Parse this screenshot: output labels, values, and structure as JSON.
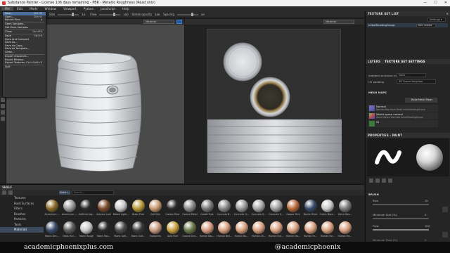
{
  "titlebar": {
    "title": "Substance Painter - License 106 days remaining - PBR - Metallic Roughness (Read only)",
    "minimize": "—",
    "maximize": "☐",
    "close": "✕"
  },
  "menubar": [
    "File",
    "Edit",
    "Mode",
    "Window",
    "Viewport",
    "Python",
    "JavaScript",
    "Help"
  ],
  "toolbar": {
    "size_label": "Size",
    "size_value": "10",
    "flow_label": "Flow",
    "flow_value": "100",
    "stroke_label": "Stroke opacity",
    "stroke_value": "100",
    "spacing_label": "Spacing",
    "spacing_value": "20"
  },
  "viewport3d": {
    "mode": "Material"
  },
  "viewport2d": {
    "mode": "Material"
  },
  "file_menu": [
    {
      "label": "New...",
      "shortcut": "Ctrl+N"
    },
    {
      "label": "Open...",
      "shortcut": "Ctrl+O"
    },
    {
      "label": "Recent Files",
      "shortcut": "▸"
    },
    {
      "sep": true
    },
    {
      "label": "Open Samples...",
      "shortcut": ""
    },
    {
      "label": "Get More Samples",
      "shortcut": ""
    },
    {
      "sep": true
    },
    {
      "label": "Close",
      "shortcut": "Ctrl+F4"
    },
    {
      "sep": true
    },
    {
      "label": "Save",
      "shortcut": "Ctrl+S"
    },
    {
      "label": "Save And Compact",
      "shortcut": ""
    },
    {
      "label": "Save As...",
      "shortcut": ""
    },
    {
      "label": "Save As Copy...",
      "shortcut": ""
    },
    {
      "label": "Save As Template...",
      "shortcut": ""
    },
    {
      "label": "Clean...",
      "shortcut": ""
    },
    {
      "sep": true
    },
    {
      "label": "Import resources...",
      "shortcut": ""
    },
    {
      "label": "Export Bitmap...",
      "shortcut": ""
    },
    {
      "label": "Export Textures...",
      "shortcut": "Ctrl+Shift+E"
    },
    {
      "sep": true
    },
    {
      "label": "Quit",
      "shortcut": ""
    }
  ],
  "texture_set_list": {
    "header": "TEXTURE SET LIST",
    "settings": "Settings ▾",
    "item": "InitialShadingGroup",
    "shader": "Main shader"
  },
  "layers_tabs": [
    "LAYERS",
    "TEXTURE SET SETTINGS"
  ],
  "texture_set_settings": {
    "ao_label": "Ambient occlusion map",
    "ao_value": "None",
    "uv_label": "UV padding",
    "uv_value": "3D Space Neighbor",
    "meshmaps_label": "MESH MAPS",
    "bake_button": "Bake Mesh Maps",
    "maps": [
      {
        "name": "Normal",
        "sub": "Normal Map from Mesh InitialShadingGroup"
      },
      {
        "name": "World space normal",
        "sub": "World Space Normals InitialShadingGroup"
      },
      {
        "name": "ID",
        "sub": ""
      }
    ]
  },
  "properties": {
    "header": "PROPERTIES - PAINT",
    "brush_label": "BRUSH",
    "size_label": "Size",
    "size_value": "10",
    "min_size_label": "Minimum Size (%)",
    "min_size_value": "0",
    "flow_label": "Flow",
    "flow_value": "100",
    "min_flow_label": "Minimum Flow (%)",
    "min_flow_value": "0"
  },
  "shelf": {
    "header": "SHELF",
    "search_placeholder": "Search...",
    "filter_tag": "Materi...",
    "categories": [
      "Textures",
      "Hard Surfaces",
      "Filters",
      "Brushes",
      "Particles",
      "Tools",
      "Materials"
    ],
    "active_category": "Materials",
    "row1": [
      {
        "name": "Aluminium ...",
        "color": "#8a6a2a"
      },
      {
        "name": "Aluminium ...",
        "color": "#9a9a9a"
      },
      {
        "name": "Artificial Lea...",
        "color": "#2a2a2a"
      },
      {
        "name": "Autumn Leaf",
        "color": "#7a4a2a"
      },
      {
        "name": "Baked Light...",
        "color": "#c8c8c8"
      },
      {
        "name": "Brass Pure",
        "color": "#b89a3a"
      },
      {
        "name": "Calf Skin",
        "color": "#c89a70"
      },
      {
        "name": "Carbon Fiber",
        "color": "#2a2a2a"
      },
      {
        "name": "Coated Metal",
        "color": "#8a8a8a"
      },
      {
        "name": "Cobalt Pure",
        "color": "#7a7a7a"
      },
      {
        "name": "Concrete B...",
        "color": "#8a8a8a"
      },
      {
        "name": "Concrete Cl...",
        "color": "#9a9a9a"
      },
      {
        "name": "Concrete S...",
        "color": "#aaaaaa"
      },
      {
        "name": "Concrete S...",
        "color": "#a0a0a0"
      },
      {
        "name": "Copper Pure",
        "color": "#b86a3a"
      },
      {
        "name": "Denim Rivet",
        "color": "#3a4a6a"
      },
      {
        "name": "Fabric Base...",
        "color": "#c8c8c8"
      },
      {
        "name": "Fabric Bas...",
        "color": "#7a7a7a"
      }
    ],
    "row2": [
      {
        "name": "Fabric Den...",
        "color": "#3a4a6a"
      },
      {
        "name": "Fabric Kni...",
        "color": "#5a5a5a"
      },
      {
        "name": "Fabric Rough",
        "color": "#c8c8c8"
      },
      {
        "name": "Fabric Rou...",
        "color": "#2a2a2a"
      },
      {
        "name": "Fabric Soft...",
        "color": "#4a4a4a"
      },
      {
        "name": "Fabric Suit...",
        "color": "#3a3a3a"
      },
      {
        "name": "Footprints",
        "color": "#c89a80"
      },
      {
        "name": "Gold Pure",
        "color": "#c8a040"
      },
      {
        "name": "Ground Gra...",
        "color": "#6a7a4a"
      },
      {
        "name": "Human Bac...",
        "color": "#d89a80"
      },
      {
        "name": "Human Bell...",
        "color": "#d8a080"
      },
      {
        "name": "Human Bu...",
        "color": "#d8a080"
      },
      {
        "name": "Human Ch...",
        "color": "#d8a080"
      },
      {
        "name": "Human Eye...",
        "color": "#d8a080"
      },
      {
        "name": "Human Fac...",
        "color": "#d8a080"
      },
      {
        "name": "Human Fe...",
        "color": "#d8a080"
      },
      {
        "name": "Human For...",
        "color": "#d8a080"
      },
      {
        "name": "Human He...",
        "color": "#d8a080"
      }
    ]
  },
  "statusbar": {
    "message": "[Project management] The project's image \"Thickness Map from Mesh InitialShadingGroup\" loaded from: /unknown origin/ was replaced with the image at: /unknown origin/ in the shelf",
    "right": "Cache Disk Usage: 94% | Version: 7.3.1"
  },
  "watermark": {
    "left": "academicphoenixplus.com",
    "right": "@academicphoenix"
  }
}
